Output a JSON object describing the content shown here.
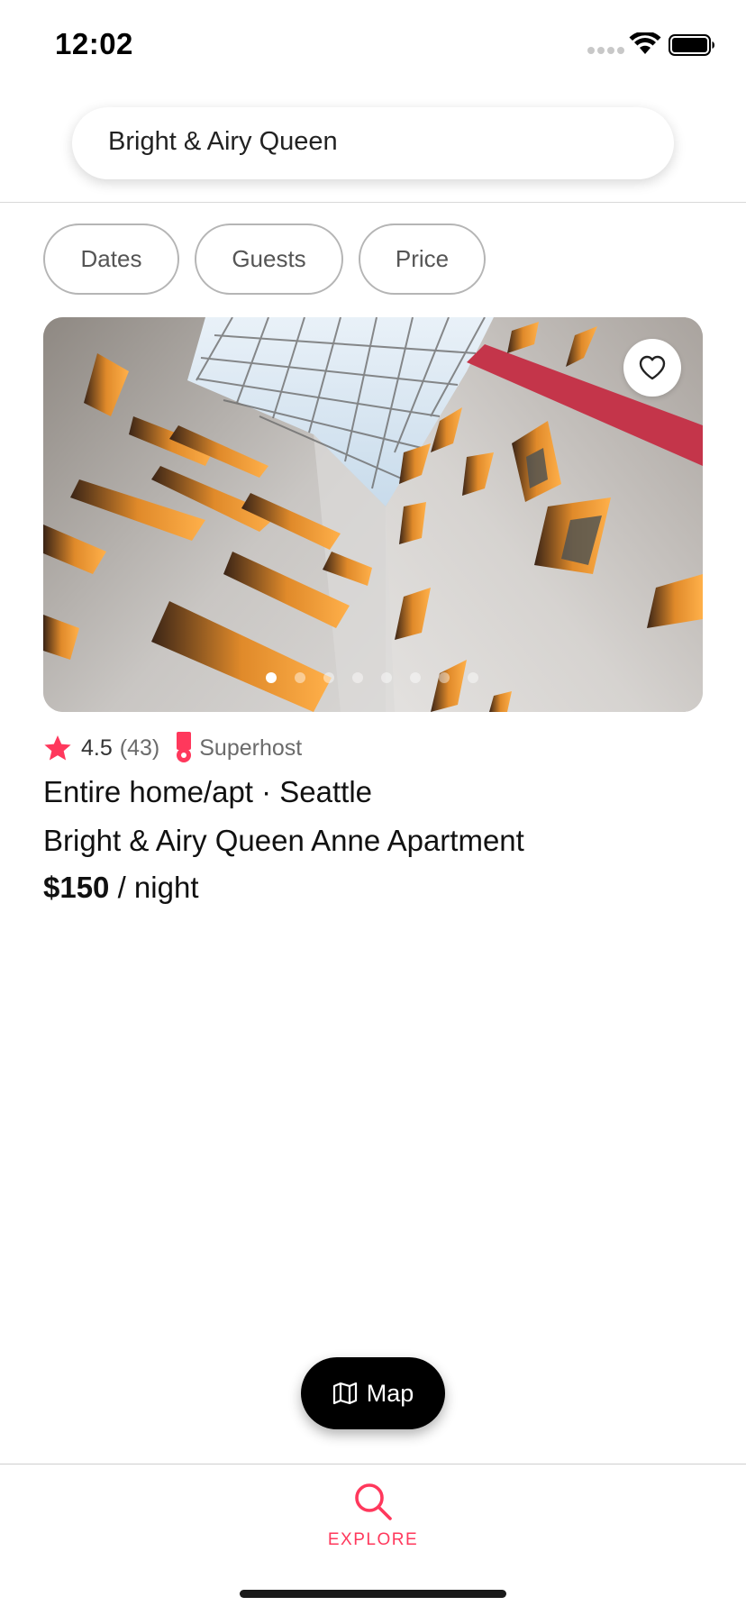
{
  "status_bar": {
    "time": "12:02",
    "icons": [
      "cellular-signal-icon",
      "wifi-icon",
      "battery-icon"
    ]
  },
  "search": {
    "value": "Bright & Airy Queen",
    "icon": "none"
  },
  "filters": [
    {
      "label": "Dates"
    },
    {
      "label": "Guests"
    },
    {
      "label": "Price"
    }
  ],
  "listing": {
    "image": {
      "description_icon": "atrium-photo",
      "favorite_icon": "heart-outline-icon",
      "carousel_total": 8,
      "carousel_active_index": 0
    },
    "rating": "4.5",
    "reviews_count": "(43)",
    "badge": "Superhost",
    "type": "Entire home/apt · Seattle",
    "title": "Bright & Airy Queen Anne Apartment",
    "price": "$150",
    "price_unit": " / night"
  },
  "map_button": {
    "label": "Map",
    "icon": "map-icon"
  },
  "tab_bar": {
    "tabs": [
      {
        "label": "EXPLORE",
        "icon": "search-icon",
        "active": true
      }
    ]
  },
  "colors": {
    "accent": "#ff385c",
    "map_button_bg": "#000000",
    "chip_border": "#b5b5b5"
  }
}
